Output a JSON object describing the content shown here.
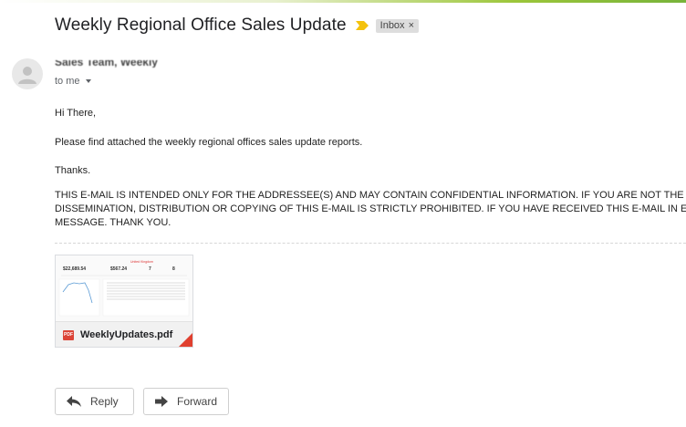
{
  "email": {
    "subject": "Weekly Regional Office Sales Update",
    "label": "Inbox",
    "label_remove": "×",
    "sender_name": "Sales Team, Weekly",
    "recipient": "to me",
    "greeting": "Hi There,",
    "message": "Please find attached the weekly regional offices sales update reports.",
    "signoff": "Thanks.",
    "disclaimer": [
      "THIS E-MAIL IS INTENDED ONLY FOR THE ADDRESSEE(S) AND MAY CONTAIN CONFIDENTIAL INFORMATION. IF YOU ARE NOT THE IN",
      "DISSEMINATION, DISTRIBUTION OR COPYING OF THIS E-MAIL IS STRICTLY PROHIBITED. IF YOU HAVE RECEIVED THIS E-MAIL IN ERI",
      "MESSAGE. THANK YOU."
    ]
  },
  "attachment": {
    "filename": "WeeklyUpdates.pdf",
    "type_badge": "PDF",
    "preview": {
      "header": "United Kingdom",
      "kpis": [
        "$22,689.54",
        "$567.24",
        "7",
        "8"
      ]
    }
  },
  "actions": {
    "reply": "Reply",
    "forward": "Forward"
  },
  "colors": {
    "importance": "#f4c20d",
    "pdf_red": "#db4437",
    "label_bg": "#dddddd"
  }
}
